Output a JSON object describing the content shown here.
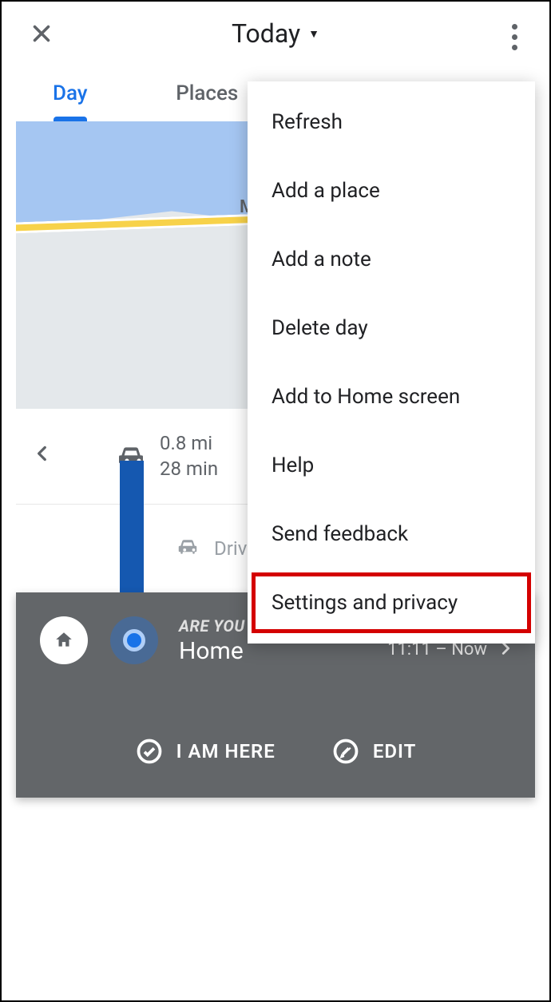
{
  "header": {
    "title": "Today"
  },
  "tabs": {
    "day": "Day",
    "places": "Places"
  },
  "map": {
    "partial_label": "M"
  },
  "trip": {
    "distance": "0.8 mi",
    "duration": "28 min"
  },
  "subrow": {
    "label": "Drivin"
  },
  "card": {
    "prompt": "ARE YOU HERE?",
    "place": "Home",
    "time": "11:11 – Now",
    "action_here": "I AM HERE",
    "action_edit": "EDIT"
  },
  "menu": {
    "items": [
      "Refresh",
      "Add a place",
      "Add a note",
      "Delete day",
      "Add to Home screen",
      "Help",
      "Send feedback",
      "Settings and privacy"
    ],
    "highlight_index": 7
  }
}
